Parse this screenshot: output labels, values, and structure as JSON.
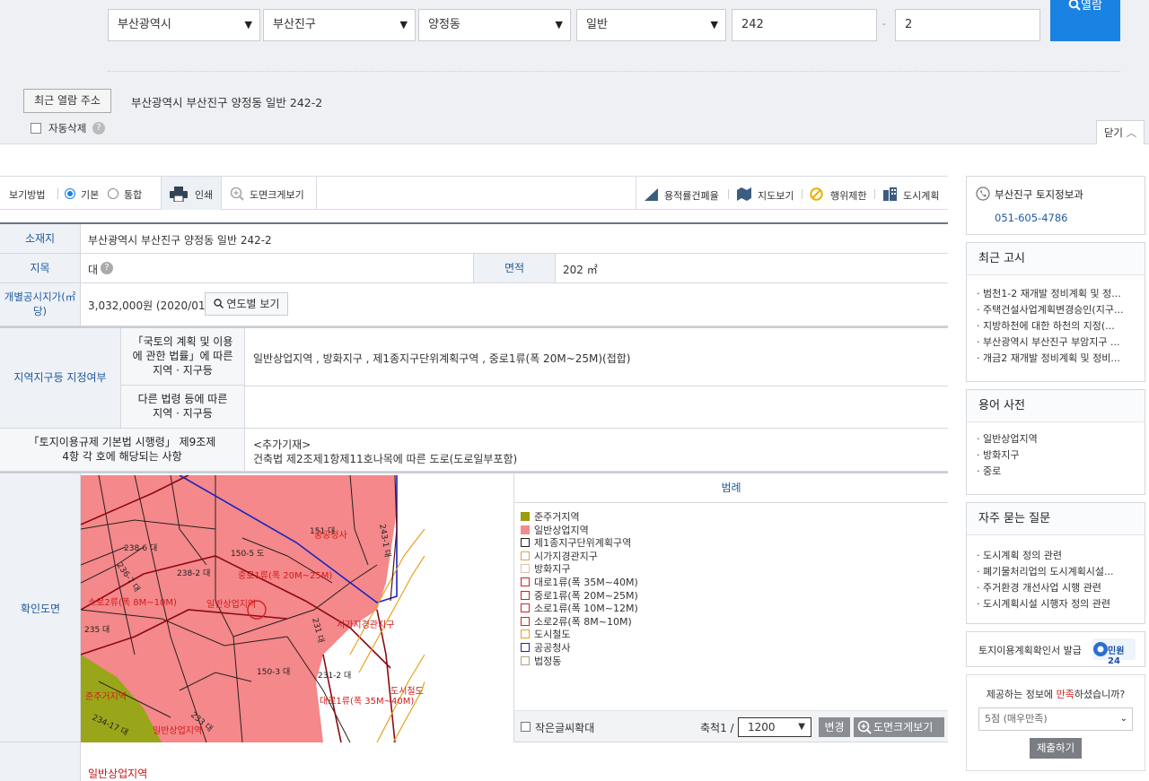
{
  "search": {
    "sido": "부산광역시",
    "sigungu": "부산진구",
    "dong": "양정동",
    "land_type": "일반",
    "main_no": "242",
    "sep": "-",
    "sub_no": "2",
    "button": "열람"
  },
  "recent": {
    "button": "최근 열람 주소",
    "address": "부산광역시 부산진구 양정동 일반 242-2",
    "auto_delete": "자동삭제",
    "close": "닫기"
  },
  "toolbar": {
    "view_mode_label": "보기방법",
    "mode_basic": "기본",
    "mode_combined": "통합",
    "print": "인쇄",
    "zoom_map": "도면크게보기",
    "far": "용적률건폐율",
    "map_view": "지도보기",
    "restrict": "행위제한",
    "city_plan": "도시계획"
  },
  "info": {
    "location_h": "소재지",
    "location": "부산광역시 부산진구 양정동 일반 242-2",
    "jimok_h": "지목",
    "jimok": "대",
    "area_h": "면적",
    "area": "202 ㎡",
    "price_h": "개별공시지가(㎡ 당)",
    "price": "3,032,000원 (2020/01)",
    "price_btn": "연도별 보기",
    "zone_h": "지역지구등 지정여부",
    "zone_sub1": "「국토의 계획 및 이용에 관한 법률」에 따른 지역 · 지구등",
    "zone_val1": "일반상업지역 , 방화지구 , 제1종지구단위계획구역 , 중로1류(폭 20M~25M)(접합)",
    "zone_sub2": "다른 법령 등에 따른 지역 · 지구등",
    "zone_val2": "",
    "reg_h": "「토지이용규제 기본법 시행령」 제9조제4항 각 호에 해당되는 사항",
    "reg_val1": "<추가기재>",
    "reg_val2": "건축법 제2조제1항제11호나목에 따른 도로(도로일부포함)",
    "map_h": "확인도면",
    "legend_h": "범례",
    "small_text": "작은글씨확대",
    "scale_label": "축척1 /",
    "scale": "1200",
    "change": "변경",
    "zoom_map": "도면크게보기",
    "bottom_zone": "일반상업지역"
  },
  "legend": [
    {
      "label": "준주거지역",
      "color": "#9b9b10",
      "fill": true
    },
    {
      "label": "일반상업지역",
      "color": "#f28b8b",
      "fill": true
    },
    {
      "label": "제1종지구단위계획구역",
      "color": "#222222",
      "fill": false
    },
    {
      "label": "시가지경관지구",
      "color": "#d9a84a",
      "fill": false
    },
    {
      "label": "방화지구",
      "color": "#e0c0b0",
      "fill": false
    },
    {
      "label": "대로1류(폭 35M~40M)",
      "color": "#d42020",
      "fill": false
    },
    {
      "label": "중로1류(폭 20M~25M)",
      "color": "#d42020",
      "fill": false
    },
    {
      "label": "소로1류(폭 10M~12M)",
      "color": "#d42020",
      "fill": false
    },
    {
      "label": "소로2류(폭 8M~10M)",
      "color": "#d42020",
      "fill": false
    },
    {
      "label": "도시철도",
      "color": "#e8a020",
      "fill": false
    },
    {
      "label": "공공청사",
      "color": "#2020c0",
      "fill": false
    },
    {
      "label": "법정동",
      "color": "#b0a080",
      "fill": false
    }
  ],
  "map_labels": {
    "l1": "151 대",
    "l2": "공공청사",
    "l3": "243-1 대",
    "l4": "150-5 도",
    "l5": "238-6 대",
    "l6": "238-2 대",
    "l7": "중로1류(폭 20M~25M)",
    "l8": "소로2류(폭 8M~10M)",
    "l9": "일반상업지역",
    "l10": "235 대",
    "l11": "시가지경관지구",
    "l12": "150-3 대",
    "l13": "231-2 대",
    "l14": "준주거지역",
    "l15": "대로1류(폭 35M~40M)",
    "l16": "도시철도",
    "l17": "234-17 대",
    "l18": "일반상업지역",
    "l19": "233 대",
    "l20": "236-7 대",
    "l21": "231 대"
  },
  "sidebar": {
    "contact_name": "부산진구 토지정보과",
    "contact_phone": "051-605-4786",
    "notice_title": "최근 고시",
    "notices": [
      "· 범천1-2 재개발 정비계획 및 정...",
      "· 주택건설사업계획변경승인(지구...",
      "· 지방하천에 대한 하천의 지정(...",
      "· 부산광역시 부산진구 부암지구 ...",
      "· 개금2 재개발 정비계획 및 정비..."
    ],
    "dict_title": "용어 사전",
    "dict": [
      "· 일반상업지역",
      "· 방화지구",
      "· 중로"
    ],
    "faq_title": "자주 묻는 질문",
    "faq": [
      "· 도시계획 정의 관련",
      "· 폐기물처리업의 도시계획시설...",
      "· 주거환경 개선사업 시행 관련",
      "· 도시계획시설 시행자 정의 관련"
    ],
    "issue": "토지이용계획확인서 발급",
    "minwon": "민원24",
    "survey_q1": "제공하는 정보에 ",
    "survey_q2": "만족",
    "survey_q3": "하셨습니까?",
    "survey_value": "5점 (매우만족)",
    "submit": "제출하기"
  }
}
